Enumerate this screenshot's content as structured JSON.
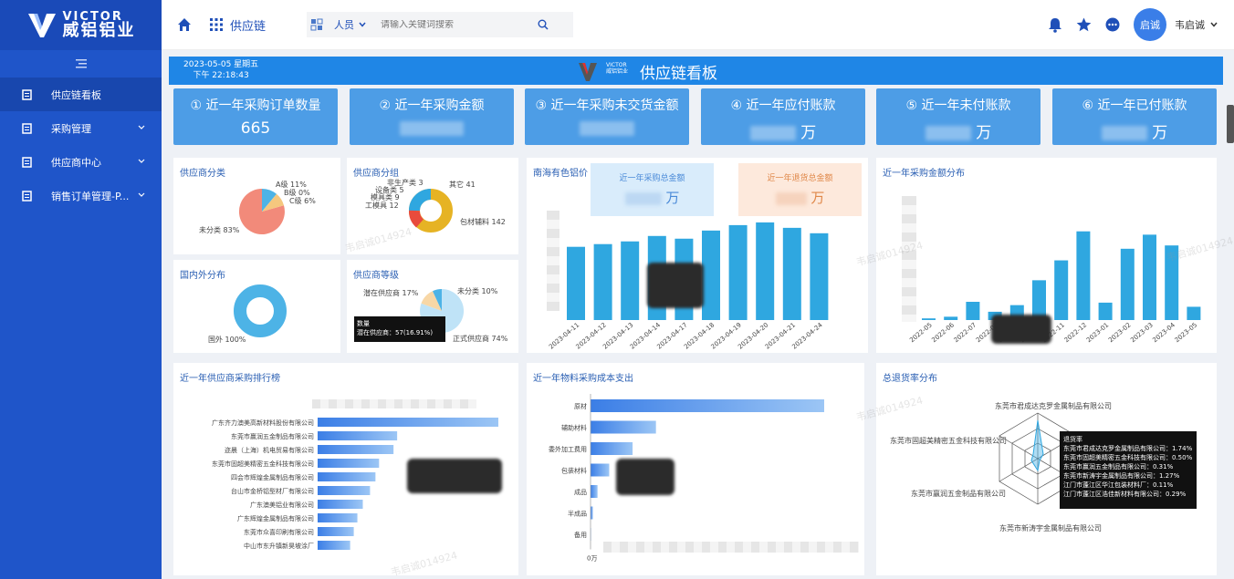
{
  "sidebar": {
    "logo_en": "VICTOR",
    "logo_cn": "威铝铝业",
    "items": [
      {
        "label": "供应链看板",
        "active": true
      },
      {
        "label": "采购管理"
      },
      {
        "label": "供应商中心"
      },
      {
        "label": "销售订单管理-P..."
      }
    ]
  },
  "topbar": {
    "title": "供应链",
    "search_category": "人员",
    "search_placeholder": "请输入关键词搜索",
    "avatar_text": "启诚",
    "username": "韦启诚"
  },
  "banner": {
    "date": "2023-05-05 星期五",
    "time": "下午 22:18:43",
    "logo_en": "VICTOR",
    "logo_cn": "威铝铝业",
    "title": "供应链看板"
  },
  "kpis": [
    {
      "title": "① 近一年采购订单数量",
      "value": "665"
    },
    {
      "title": "② 近一年采购金额",
      "value": ""
    },
    {
      "title": "③ 近一年采购未交货金额",
      "value": ""
    },
    {
      "title": "④ 近一年应付账款",
      "value": "万"
    },
    {
      "title": "⑤ 近一年未付账款",
      "value": "万"
    },
    {
      "title": "⑥ 近一年已付账款",
      "value": "万"
    }
  ],
  "cards": {
    "supplier_category": {
      "title": "供应商分类",
      "labels": [
        "A级 11%",
        "B级 0%",
        "C级 6%",
        "未分类 83%"
      ]
    },
    "supplier_group": {
      "title": "供应商分组",
      "labels": [
        "非生产类 3",
        "设备类 5",
        "模具类 9",
        "工模具 12",
        "其它 41",
        "包材辅料 142"
      ]
    },
    "domestic": {
      "title": "国内外分布",
      "labels": [
        "国外 100%"
      ]
    },
    "supplier_level": {
      "title": "供应商等级",
      "labels": [
        "潜在供应商 17%",
        "未分类 10%",
        "正式供应商 74%"
      ],
      "tooltip_title": "数量",
      "tooltip_text": "潜在供应商：57(16.91%)"
    },
    "nanhai": {
      "title": "南海有色铝价",
      "box1": "近一年采购总金额",
      "box1_value": "万",
      "box2": "近一年退货总金额",
      "box2_value": "万"
    },
    "purchase_dist": {
      "title": "近一年采购金额分布"
    },
    "ranking": {
      "title": "近一年供应商采购排行榜"
    },
    "material_cost": {
      "title": "近一年物料采购成本支出",
      "axis_zero": "0万"
    },
    "return_rate": {
      "title": "总退货率分布",
      "radar_labels": [
        "东莞市君成达克罗金属制品有限公司",
        "东莞市固超美精密五金科技有限公司",
        "东莞市赢润五金制品有限公司",
        "东莞市新涛宇金属制品有限公司"
      ],
      "tooltip_title": "退货率",
      "tooltip_lines": [
        "东莞市君成达克罗金属制品有限公司：1.74%",
        "东莞市固超美精密五金科技有限公司：0.50%",
        "东莞市赢润五金制品有限公司：0.31%",
        "东莞市新涛宇金属制品有限公司：1.27%",
        "江门市蓬江区华江包装材料厂：0.11%",
        "江门市蓬江区浩佳新材料有限公司：0.29%"
      ]
    }
  },
  "watermark": "韦启诚014924",
  "colors": {
    "sidebar": "#1f55c9",
    "banner": "#1f86e6",
    "kpi": "#4d9de6",
    "bar": "#2fa7e0"
  },
  "chart_data": [
    {
      "type": "pie",
      "title": "供应商分类",
      "categories": [
        "A级",
        "B级",
        "C级",
        "未分类"
      ],
      "values": [
        11,
        0,
        6,
        83
      ]
    },
    {
      "type": "pie",
      "title": "供应商分组",
      "categories": [
        "非生产类",
        "设备类",
        "模具类",
        "工模具",
        "其它",
        "包材辅料"
      ],
      "values": [
        3,
        5,
        9,
        12,
        41,
        142
      ]
    },
    {
      "type": "pie",
      "title": "国内外分布",
      "categories": [
        "国外"
      ],
      "values": [
        100
      ]
    },
    {
      "type": "pie",
      "title": "供应商等级",
      "categories": [
        "潜在供应商",
        "未分类",
        "正式供应商"
      ],
      "values": [
        17,
        10,
        74
      ]
    },
    {
      "type": "bar",
      "title": "南海有色铝价",
      "categories": [
        "2023-04-11",
        "2023-04-12",
        "2023-04-13",
        "2023-04-14",
        "2023-04-17",
        "2023-04-18",
        "2023-04-19",
        "2023-04-20",
        "2023-04-21",
        "2023-04-24"
      ],
      "values": [
        18.2,
        18.3,
        18.4,
        18.6,
        18.5,
        18.8,
        19.0,
        19.1,
        18.9,
        18.7
      ]
    },
    {
      "type": "bar",
      "title": "近一年采购金额分布",
      "categories": [
        "2022-05",
        "2022-06",
        "2022-07",
        "2022-08",
        "2022-09",
        "2022-10",
        "2022-11",
        "2022-12",
        "2023-01",
        "2023-02",
        "2023-03",
        "2023-04",
        "2023-05"
      ],
      "values": [
        2,
        4,
        22,
        10,
        18,
        48,
        72,
        107,
        21,
        86,
        103,
        90,
        16
      ]
    },
    {
      "type": "bar",
      "title": "近一年供应商采购排行榜",
      "categories": [
        "广东齐力澳美高新材料股份有限公司",
        "东莞市赢润五金制品有限公司",
        "迩晨（上海）机电贸易有限公司",
        "东莞市固超美精密五金科技有限公司",
        "四会市辉煌金属制品有限公司",
        "台山市金桥铝型材厂有限公司",
        "广东澳美铝业有限公司",
        "广东辉煌金属制品有限公司",
        "东莞市众喜印刷有限公司",
        "中山市东升镇新昊坡涂厂"
      ],
      "values": [
        100,
        44,
        42,
        34,
        32,
        29,
        25,
        22,
        20,
        18
      ]
    },
    {
      "type": "bar",
      "title": "近一年物料采购成本支出",
      "categories": [
        "原材",
        "辅助材料",
        "委外加工费用",
        "包装材料",
        "成品",
        "半成品",
        "备用"
      ],
      "values": [
        100,
        28,
        18,
        8,
        3,
        1,
        0
      ]
    }
  ]
}
